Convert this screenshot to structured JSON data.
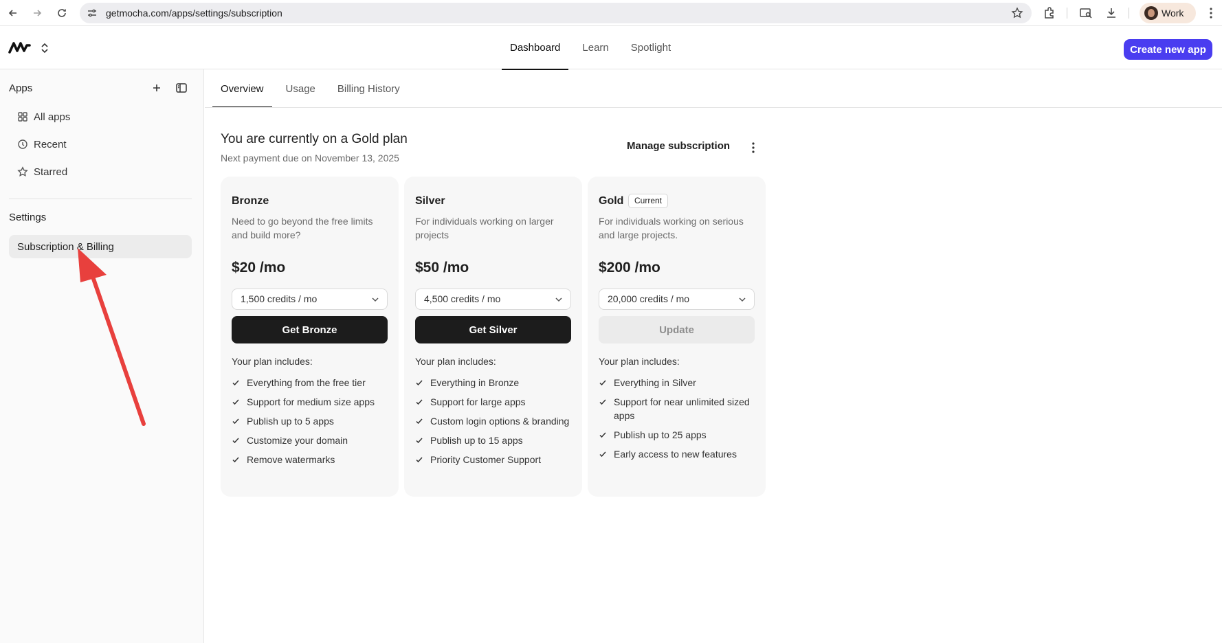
{
  "browser": {
    "url": "getmocha.com/apps/settings/subscription",
    "profile_label": "Work"
  },
  "header": {
    "nav": [
      {
        "label": "Dashboard",
        "active": true
      },
      {
        "label": "Learn",
        "active": false
      },
      {
        "label": "Spotlight",
        "active": false
      }
    ],
    "create_label": "Create new app",
    "accent": "#4a3df0"
  },
  "sidebar": {
    "apps_title": "Apps",
    "items": [
      {
        "label": "All apps",
        "icon": "grid-icon"
      },
      {
        "label": "Recent",
        "icon": "clock-icon"
      },
      {
        "label": "Starred",
        "icon": "star-icon"
      }
    ],
    "settings_title": "Settings",
    "settings_items": [
      {
        "label": "Subscription & Billing",
        "selected": true
      }
    ]
  },
  "sub_tabs": [
    {
      "label": "Overview",
      "active": true
    },
    {
      "label": "Usage",
      "active": false
    },
    {
      "label": "Billing History",
      "active": false
    }
  ],
  "plan": {
    "heading": "You are currently on a Gold plan",
    "next_payment": "Next payment due on November 13, 2025",
    "manage_label": "Manage subscription"
  },
  "cards": [
    {
      "name": "Bronze",
      "badge": "",
      "desc": "Need to go beyond the free limits and build more?",
      "price": "$20 /mo",
      "credits": "1,500 credits / mo",
      "cta": "Get Bronze",
      "cta_style": "dark",
      "includes_label": "Your plan includes:",
      "features": [
        "Everything from the free tier",
        "Support for medium size apps",
        "Publish up to 5 apps",
        "Customize your domain",
        "Remove watermarks"
      ]
    },
    {
      "name": "Silver",
      "badge": "",
      "desc": "For individuals working on larger projects",
      "price": "$50 /mo",
      "credits": "4,500 credits / mo",
      "cta": "Get Silver",
      "cta_style": "dark",
      "includes_label": "Your plan includes:",
      "features": [
        "Everything in Bronze",
        "Support for large apps",
        "Custom login options & branding",
        "Publish up to 15 apps",
        "Priority Customer Support"
      ]
    },
    {
      "name": "Gold",
      "badge": "Current",
      "desc": "For individuals working on serious and large projects.",
      "price": "$200 /mo",
      "credits": "20,000 credits / mo",
      "cta": "Update",
      "cta_style": "disabled",
      "includes_label": "Your plan includes:",
      "features": [
        "Everything in Silver",
        "Support for near unlimited sized apps",
        "Publish up to 25 apps",
        "Early access to new features"
      ]
    }
  ]
}
